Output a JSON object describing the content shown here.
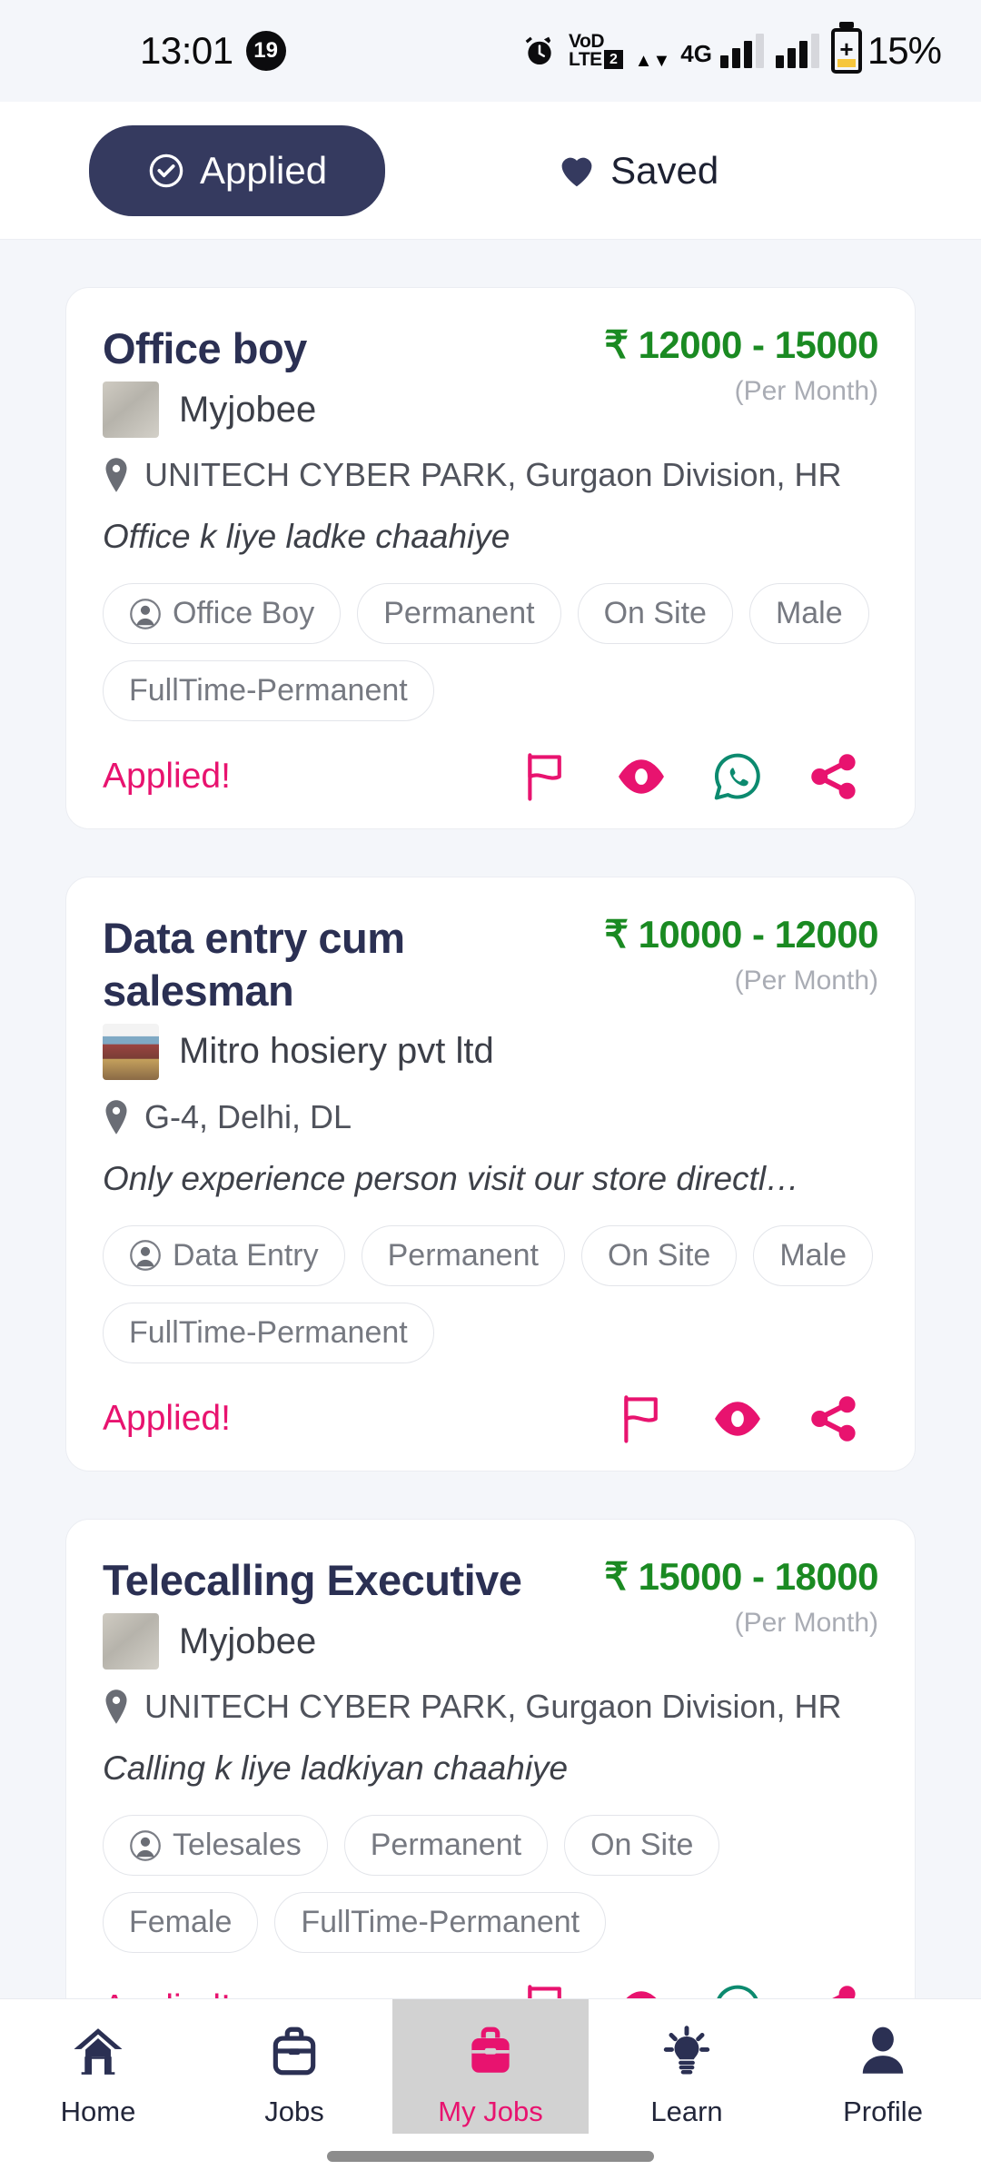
{
  "status_bar": {
    "time": "13:01",
    "notification_count": "19",
    "alarm_icon": "alarm-clock-icon",
    "volte_line1": "VoD",
    "volte_line2": "LTE",
    "volte_sim": "2",
    "network_type": "4G",
    "battery_percent": "15%"
  },
  "tabs": {
    "applied": {
      "label": "Applied",
      "icon": "check-circle-icon",
      "active": true
    },
    "saved": {
      "label": "Saved",
      "icon": "heart-icon",
      "active": false
    }
  },
  "jobs": [
    {
      "title": "Office boy",
      "company": "Myjobee",
      "company_logo": "company-avatar-blurred",
      "salary": "₹ 12000 - 15000",
      "salary_period": "(Per Month)",
      "location": "UNITECH CYBER PARK, Gurgaon Division, HR",
      "description": "Office k liye ladke chaahiye",
      "tags": [
        "Office Boy",
        "Permanent",
        "On Site",
        "Male",
        "FullTime-Permanent"
      ],
      "status_label": "Applied!",
      "actions": [
        "flag-icon",
        "eye-icon",
        "whatsapp-icon",
        "share-icon"
      ]
    },
    {
      "title": "Data entry cum salesman",
      "company": "Mitro hosiery pvt ltd",
      "company_logo": "company-avatar-storefront",
      "salary": "₹ 10000 - 12000",
      "salary_period": "(Per Month)",
      "location": "G-4, Delhi, DL",
      "description": "Only experience person visit our store directl…",
      "tags": [
        "Data Entry",
        "Permanent",
        "On Site",
        "Male",
        "FullTime-Permanent"
      ],
      "status_label": "Applied!",
      "actions": [
        "flag-icon",
        "eye-icon",
        "share-icon"
      ]
    },
    {
      "title": "Telecalling Executive",
      "company": "Myjobee",
      "company_logo": "company-avatar-blurred",
      "salary": "₹ 15000 - 18000",
      "salary_period": "(Per Month)",
      "location": "UNITECH CYBER PARK, Gurgaon Division, HR",
      "description": "Calling k liye ladkiyan chaahiye",
      "tags": [
        "Telesales",
        "Permanent",
        "On Site",
        "Female",
        "FullTime-Permanent"
      ],
      "status_label": "Applied!",
      "actions": [
        "flag-icon",
        "eye-icon",
        "whatsapp-icon",
        "share-icon"
      ]
    }
  ],
  "bottom_nav": [
    {
      "label": "Home",
      "icon": "home-icon",
      "active": false
    },
    {
      "label": "Jobs",
      "icon": "briefcase-icon",
      "active": false
    },
    {
      "label": "My Jobs",
      "icon": "briefcase-filled-icon",
      "active": true
    },
    {
      "label": "Learn",
      "icon": "lightbulb-icon",
      "active": false
    },
    {
      "label": "Profile",
      "icon": "person-icon",
      "active": false
    }
  ],
  "colors": {
    "accent_pink": "#e8136f",
    "navy": "#353a5f",
    "salary_green": "#1a8a22",
    "whatsapp_teal": "#0c8a6f",
    "page_background": "#f4f6fa"
  }
}
